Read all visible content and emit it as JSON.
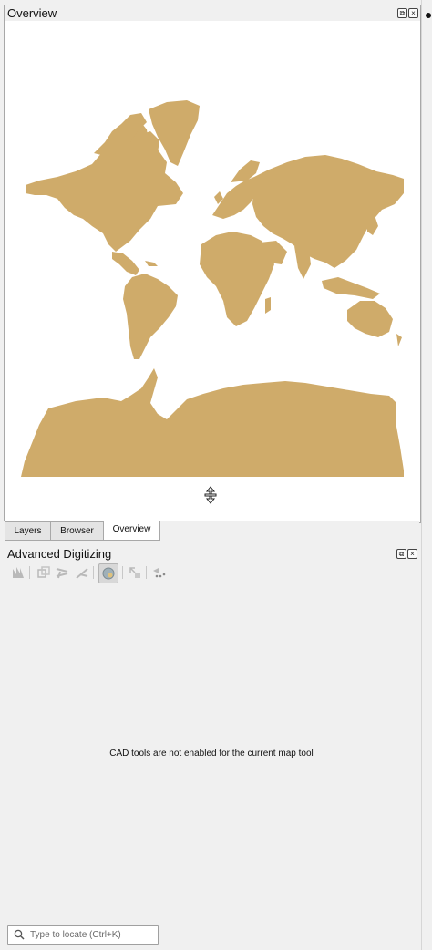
{
  "overview_panel": {
    "title": "Overview",
    "float_icon": "float-window-icon",
    "close_icon": "close-icon",
    "land_color": "#cfab6a",
    "background_color": "#ffffff"
  },
  "tabs": [
    {
      "label": "Layers",
      "active": false
    },
    {
      "label": "Browser",
      "active": false
    },
    {
      "label": "Overview",
      "active": true
    }
  ],
  "advanced_digitizing": {
    "title": "Advanced Digitizing",
    "message": "CAD tools are not enabled for the current map tool",
    "tools": [
      "construction-mode-icon",
      "parallel-icon",
      "perpendicular-icon",
      "snap-to-common-angles-icon",
      "enable-cad-icon",
      "settings-icon",
      "floater-icon"
    ]
  },
  "locator": {
    "placeholder": "Type to locate (Ctrl+K)"
  }
}
